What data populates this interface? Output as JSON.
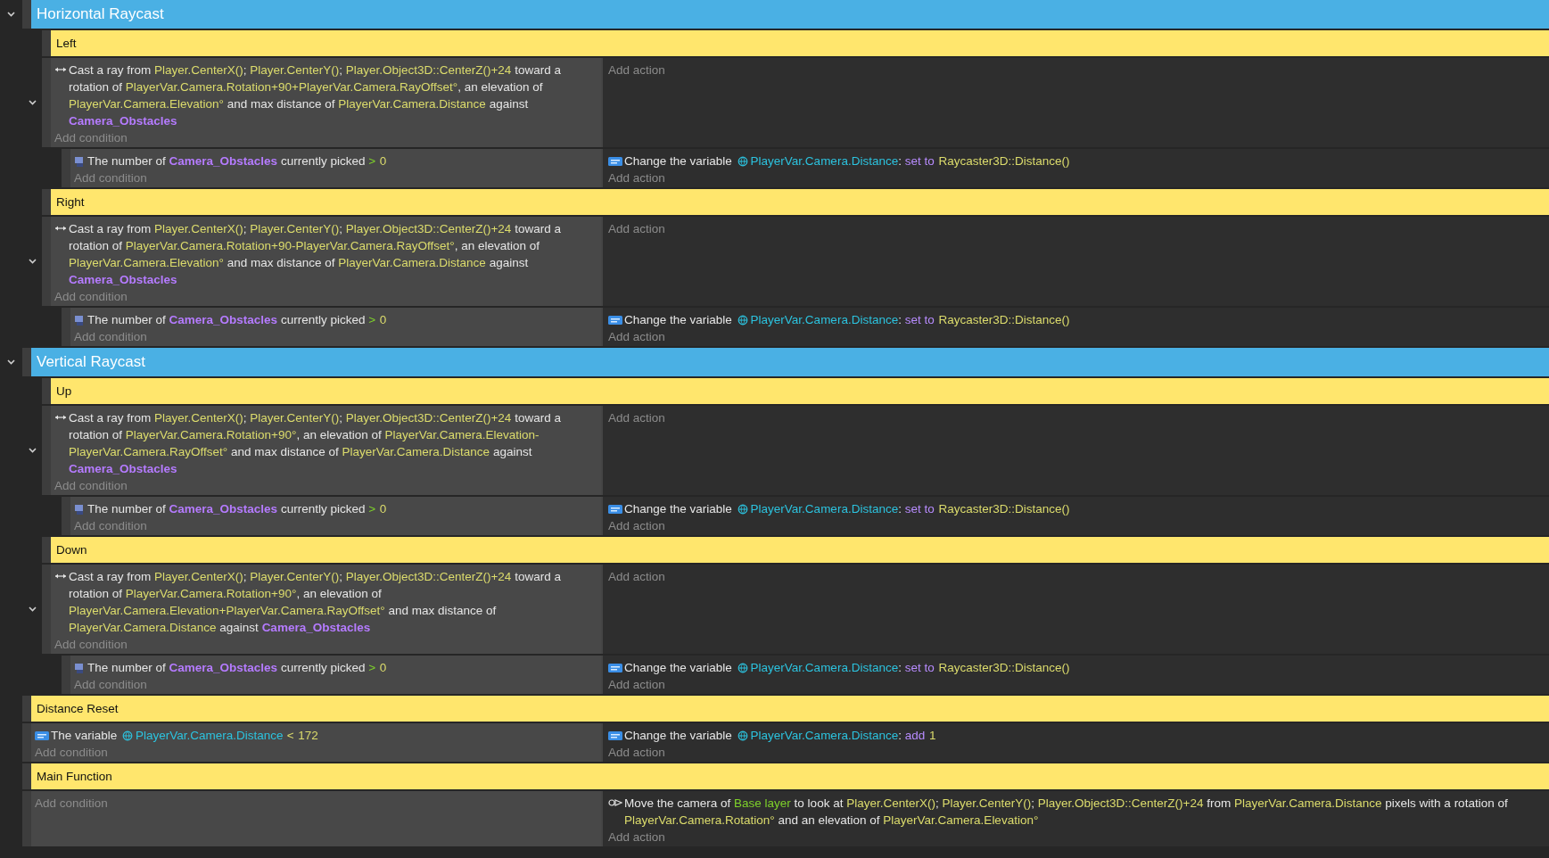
{
  "events": [
    {
      "kind": "group",
      "title": "Horizontal Raycast",
      "expanded": true,
      "children": [
        {
          "kind": "comment",
          "text": "Left"
        },
        {
          "kind": "standard",
          "expanded": true,
          "add_condition": "Add condition",
          "add_action": "Add action",
          "conditions": [
            {
              "kind": "raycast",
              "parts": [
                {
                  "kind": "plain",
                  "text": "Cast a ray from "
                },
                {
                  "kind": "expr",
                  "text": "Player.CenterX()"
                },
                {
                  "kind": "plain",
                  "text": "; "
                },
                {
                  "kind": "expr",
                  "text": "Player.CenterY()"
                },
                {
                  "kind": "plain",
                  "text": "; "
                },
                {
                  "kind": "expr",
                  "text": "Player.Object3D::CenterZ()+24"
                },
                {
                  "kind": "plain",
                  "text": " toward a rotation of "
                },
                {
                  "kind": "expr",
                  "text": "PlayerVar.Camera.Rotation+90+PlayerVar.Camera.RayOffset°"
                },
                {
                  "kind": "plain",
                  "text": ", an elevation of "
                },
                {
                  "kind": "expr",
                  "text": "PlayerVar.Camera.Elevation°"
                },
                {
                  "kind": "plain",
                  "text": " and max distance of "
                },
                {
                  "kind": "expr",
                  "text": "PlayerVar.Camera.Distance"
                },
                {
                  "kind": "plain",
                  "text": " against "
                },
                {
                  "kind": "object",
                  "text": "Camera_Obstacles"
                }
              ]
            }
          ],
          "children": [
            {
              "kind": "standard",
              "add_condition": "Add condition",
              "add_action": "Add action",
              "conditions": [
                {
                  "kind": "object_count",
                  "parts": [
                    {
                      "kind": "plain",
                      "text": "The number of "
                    },
                    {
                      "kind": "object",
                      "text": "Camera_Obstacles"
                    },
                    {
                      "kind": "plain",
                      "text": " currently picked "
                    },
                    {
                      "kind": "op",
                      "text": ">"
                    },
                    {
                      "kind": "expr",
                      "text": "0"
                    }
                  ]
                }
              ],
              "actions": [
                {
                  "kind": "variable",
                  "parts": [
                    {
                      "kind": "plain",
                      "text": "Change the variable "
                    },
                    {
                      "kind": "var",
                      "text": "PlayerVar.Camera.Distance"
                    },
                    {
                      "kind": "plain",
                      "text": ": "
                    },
                    {
                      "kind": "keyword",
                      "text": "set to"
                    },
                    {
                      "kind": "expr",
                      "text": "Raycaster3D::Distance()"
                    }
                  ]
                }
              ]
            }
          ]
        },
        {
          "kind": "comment",
          "text": "Right"
        },
        {
          "kind": "standard",
          "expanded": true,
          "add_condition": "Add condition",
          "add_action": "Add action",
          "conditions": [
            {
              "kind": "raycast",
              "parts": [
                {
                  "kind": "plain",
                  "text": "Cast a ray from "
                },
                {
                  "kind": "expr",
                  "text": "Player.CenterX()"
                },
                {
                  "kind": "plain",
                  "text": "; "
                },
                {
                  "kind": "expr",
                  "text": "Player.CenterY()"
                },
                {
                  "kind": "plain",
                  "text": "; "
                },
                {
                  "kind": "expr",
                  "text": "Player.Object3D::CenterZ()+24"
                },
                {
                  "kind": "plain",
                  "text": " toward a rotation of "
                },
                {
                  "kind": "expr",
                  "text": "PlayerVar.Camera.Rotation+90-PlayerVar.Camera.RayOffset°"
                },
                {
                  "kind": "plain",
                  "text": ", an elevation of "
                },
                {
                  "kind": "expr",
                  "text": "PlayerVar.Camera.Elevation°"
                },
                {
                  "kind": "plain",
                  "text": " and max distance of "
                },
                {
                  "kind": "expr",
                  "text": "PlayerVar.Camera.Distance"
                },
                {
                  "kind": "plain",
                  "text": " against "
                },
                {
                  "kind": "object",
                  "text": "Camera_Obstacles"
                }
              ]
            }
          ],
          "children": [
            {
              "kind": "standard",
              "add_condition": "Add condition",
              "add_action": "Add action",
              "conditions": [
                {
                  "kind": "object_count",
                  "parts": [
                    {
                      "kind": "plain",
                      "text": "The number of "
                    },
                    {
                      "kind": "object",
                      "text": "Camera_Obstacles"
                    },
                    {
                      "kind": "plain",
                      "text": " currently picked "
                    },
                    {
                      "kind": "op",
                      "text": ">"
                    },
                    {
                      "kind": "expr",
                      "text": "0"
                    }
                  ]
                }
              ],
              "actions": [
                {
                  "kind": "variable",
                  "parts": [
                    {
                      "kind": "plain",
                      "text": "Change the variable "
                    },
                    {
                      "kind": "var",
                      "text": "PlayerVar.Camera.Distance"
                    },
                    {
                      "kind": "plain",
                      "text": ": "
                    },
                    {
                      "kind": "keyword",
                      "text": "set to"
                    },
                    {
                      "kind": "expr",
                      "text": "Raycaster3D::Distance()"
                    }
                  ]
                }
              ]
            }
          ]
        }
      ]
    },
    {
      "kind": "group",
      "title": "Vertical Raycast",
      "expanded": true,
      "children": [
        {
          "kind": "comment",
          "text": "Up"
        },
        {
          "kind": "standard",
          "expanded": true,
          "add_condition": "Add condition",
          "add_action": "Add action",
          "conditions": [
            {
              "kind": "raycast",
              "parts": [
                {
                  "kind": "plain",
                  "text": "Cast a ray from "
                },
                {
                  "kind": "expr",
                  "text": "Player.CenterX()"
                },
                {
                  "kind": "plain",
                  "text": "; "
                },
                {
                  "kind": "expr",
                  "text": "Player.CenterY()"
                },
                {
                  "kind": "plain",
                  "text": "; "
                },
                {
                  "kind": "expr",
                  "text": "Player.Object3D::CenterZ()+24"
                },
                {
                  "kind": "plain",
                  "text": " toward a rotation of "
                },
                {
                  "kind": "expr",
                  "text": "PlayerVar.Camera.Rotation+90°"
                },
                {
                  "kind": "plain",
                  "text": ", an elevation of "
                },
                {
                  "kind": "expr",
                  "text": "PlayerVar.Camera.Elevation-PlayerVar.Camera.RayOffset°"
                },
                {
                  "kind": "plain",
                  "text": " and max distance of "
                },
                {
                  "kind": "expr",
                  "text": "PlayerVar.Camera.Distance"
                },
                {
                  "kind": "plain",
                  "text": " against "
                },
                {
                  "kind": "object",
                  "text": "Camera_Obstacles"
                }
              ]
            }
          ],
          "children": [
            {
              "kind": "standard",
              "add_condition": "Add condition",
              "add_action": "Add action",
              "conditions": [
                {
                  "kind": "object_count",
                  "parts": [
                    {
                      "kind": "plain",
                      "text": "The number of "
                    },
                    {
                      "kind": "object",
                      "text": "Camera_Obstacles"
                    },
                    {
                      "kind": "plain",
                      "text": " currently picked "
                    },
                    {
                      "kind": "op",
                      "text": ">"
                    },
                    {
                      "kind": "expr",
                      "text": "0"
                    }
                  ]
                }
              ],
              "actions": [
                {
                  "kind": "variable",
                  "parts": [
                    {
                      "kind": "plain",
                      "text": "Change the variable "
                    },
                    {
                      "kind": "var",
                      "text": "PlayerVar.Camera.Distance"
                    },
                    {
                      "kind": "plain",
                      "text": ": "
                    },
                    {
                      "kind": "keyword",
                      "text": "set to"
                    },
                    {
                      "kind": "expr",
                      "text": "Raycaster3D::Distance()"
                    }
                  ]
                }
              ]
            }
          ]
        },
        {
          "kind": "comment",
          "text": "Down"
        },
        {
          "kind": "standard",
          "expanded": true,
          "add_condition": "Add condition",
          "add_action": "Add action",
          "conditions": [
            {
              "kind": "raycast",
              "parts": [
                {
                  "kind": "plain",
                  "text": "Cast a ray from "
                },
                {
                  "kind": "expr",
                  "text": "Player.CenterX()"
                },
                {
                  "kind": "plain",
                  "text": "; "
                },
                {
                  "kind": "expr",
                  "text": "Player.CenterY()"
                },
                {
                  "kind": "plain",
                  "text": "; "
                },
                {
                  "kind": "expr",
                  "text": "Player.Object3D::CenterZ()+24"
                },
                {
                  "kind": "plain",
                  "text": " toward a rotation of "
                },
                {
                  "kind": "expr",
                  "text": "PlayerVar.Camera.Rotation+90°"
                },
                {
                  "kind": "plain",
                  "text": ", an elevation of "
                },
                {
                  "kind": "expr",
                  "text": "PlayerVar.Camera.Elevation+PlayerVar.Camera.RayOffset°"
                },
                {
                  "kind": "plain",
                  "text": " and max distance of "
                },
                {
                  "kind": "expr",
                  "text": "PlayerVar.Camera.Distance"
                },
                {
                  "kind": "plain",
                  "text": " against "
                },
                {
                  "kind": "object",
                  "text": "Camera_Obstacles"
                }
              ]
            }
          ],
          "children": [
            {
              "kind": "standard",
              "add_condition": "Add condition",
              "add_action": "Add action",
              "conditions": [
                {
                  "kind": "object_count",
                  "parts": [
                    {
                      "kind": "plain",
                      "text": "The number of "
                    },
                    {
                      "kind": "object",
                      "text": "Camera_Obstacles"
                    },
                    {
                      "kind": "plain",
                      "text": " currently picked "
                    },
                    {
                      "kind": "op",
                      "text": ">"
                    },
                    {
                      "kind": "expr",
                      "text": "0"
                    }
                  ]
                }
              ],
              "actions": [
                {
                  "kind": "variable",
                  "parts": [
                    {
                      "kind": "plain",
                      "text": "Change the variable "
                    },
                    {
                      "kind": "var",
                      "text": "PlayerVar.Camera.Distance"
                    },
                    {
                      "kind": "plain",
                      "text": ": "
                    },
                    {
                      "kind": "keyword",
                      "text": "set to"
                    },
                    {
                      "kind": "expr",
                      "text": "Raycaster3D::Distance()"
                    }
                  ]
                }
              ]
            }
          ]
        }
      ]
    },
    {
      "kind": "comment",
      "text": "Distance Reset"
    },
    {
      "kind": "standard",
      "add_condition": "Add condition",
      "add_action": "Add action",
      "conditions": [
        {
          "kind": "variable",
          "parts": [
            {
              "kind": "plain",
              "text": "The variable "
            },
            {
              "kind": "var",
              "text": "PlayerVar.Camera.Distance"
            },
            {
              "kind": "compare",
              "text": "<"
            },
            {
              "kind": "expr",
              "text": "172"
            }
          ]
        }
      ],
      "actions": [
        {
          "kind": "variable",
          "parts": [
            {
              "kind": "plain",
              "text": "Change the variable "
            },
            {
              "kind": "var",
              "text": "PlayerVar.Camera.Distance"
            },
            {
              "kind": "plain",
              "text": ": "
            },
            {
              "kind": "keyword",
              "text": "add"
            },
            {
              "kind": "expr",
              "text": "1"
            }
          ]
        }
      ]
    },
    {
      "kind": "comment",
      "text": "Main Function"
    },
    {
      "kind": "standard",
      "add_condition": "Add condition",
      "add_action": "Add action",
      "actions": [
        {
          "kind": "camera",
          "parts": [
            {
              "kind": "plain",
              "text": "Move the camera of "
            },
            {
              "kind": "layer",
              "text": "Base layer"
            },
            {
              "kind": "plain",
              "text": " to look at "
            },
            {
              "kind": "expr",
              "text": "Player.CenterX()"
            },
            {
              "kind": "plain",
              "text": "; "
            },
            {
              "kind": "expr",
              "text": "Player.CenterY()"
            },
            {
              "kind": "plain",
              "text": "; "
            },
            {
              "kind": "expr",
              "text": "Player.Object3D::CenterZ()+24"
            },
            {
              "kind": "plain",
              "text": " from "
            },
            {
              "kind": "expr",
              "text": "PlayerVar.Camera.Distance"
            },
            {
              "kind": "plain",
              "text": " pixels with a rotation of "
            },
            {
              "kind": "expr",
              "text": "PlayerVar.Camera.Rotation°"
            },
            {
              "kind": "plain",
              "text": " and an elevation of "
            },
            {
              "kind": "expr",
              "text": "PlayerVar.Camera.Elevation°"
            }
          ]
        }
      ]
    }
  ]
}
